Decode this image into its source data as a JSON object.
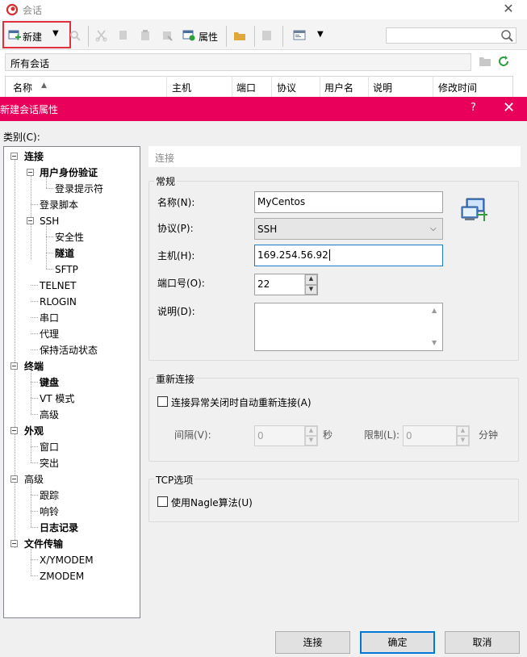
{
  "back_window": {
    "title": "会话",
    "toolbar": {
      "new_label": "新建",
      "properties_label": "属性"
    },
    "all_sessions": "所有会话",
    "columns": [
      "名称",
      "主机",
      "端口",
      "协议",
      "用户名",
      "说明",
      "修改时间"
    ]
  },
  "dialog": {
    "title": "新建会话属性",
    "help": "?",
    "category_label": "类别(C):",
    "tree": [
      {
        "label": "连接",
        "bold": true
      },
      {
        "label": "用户身份验证",
        "bold": true
      },
      {
        "label": "登录提示符",
        "bold": false
      },
      {
        "label": "登录脚本",
        "bold": false
      },
      {
        "label": "SSH",
        "bold": false
      },
      {
        "label": "安全性",
        "bold": false
      },
      {
        "label": "隧道",
        "bold": true
      },
      {
        "label": "SFTP",
        "bold": false
      },
      {
        "label": "TELNET",
        "bold": false
      },
      {
        "label": "RLOGIN",
        "bold": false
      },
      {
        "label": "串口",
        "bold": false
      },
      {
        "label": "代理",
        "bold": false
      },
      {
        "label": "保持活动状态",
        "bold": false
      },
      {
        "label": "终端",
        "bold": true
      },
      {
        "label": "键盘",
        "bold": true
      },
      {
        "label": "VT 模式",
        "bold": false
      },
      {
        "label": "高级",
        "bold": false
      },
      {
        "label": "外观",
        "bold": true
      },
      {
        "label": "窗口",
        "bold": false
      },
      {
        "label": "突出",
        "bold": false
      },
      {
        "label": "高级",
        "bold": false
      },
      {
        "label": "跟踪",
        "bold": false
      },
      {
        "label": "响铃",
        "bold": false
      },
      {
        "label": "日志记录",
        "bold": true
      },
      {
        "label": "文件传输",
        "bold": true
      },
      {
        "label": "X/YMODEM",
        "bold": false
      },
      {
        "label": "ZMODEM",
        "bold": false
      }
    ],
    "section_header": "连接",
    "general": {
      "title": "常规",
      "name_label": "名称(N):",
      "name_value": "MyCentos",
      "protocol_label": "协议(P):",
      "protocol_value": "SSH",
      "host_label": "主机(H):",
      "host_value": "169.254.56.92",
      "port_label": "端口号(O):",
      "port_value": "22",
      "desc_label": "说明(D):",
      "desc_value": ""
    },
    "reconnect": {
      "title": "重新连接",
      "auto_reconnect_label": "连接异常关闭时自动重新连接(A)",
      "auto_reconnect_checked": false,
      "interval_label": "间隔(V):",
      "interval_value": "0",
      "interval_unit": "秒",
      "limit_label": "限制(L):",
      "limit_value": "0",
      "limit_unit": "分钟"
    },
    "tcp": {
      "title": "TCP选项",
      "nagle_label": "使用Nagle算法(U)",
      "nagle_checked": false
    },
    "buttons": {
      "connect": "连接",
      "ok": "确定",
      "cancel": "取消"
    }
  },
  "colors": {
    "dialog_titlebar": "#e8005a",
    "highlight_frame": "#e03040",
    "focus_border": "#1979ca"
  }
}
